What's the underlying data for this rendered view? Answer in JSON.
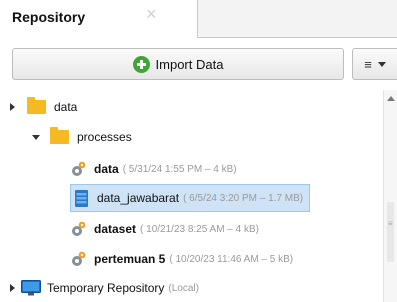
{
  "tab": {
    "title": "Repository",
    "close_glyph": "×"
  },
  "toolbar": {
    "import_label": "Import Data",
    "import_icon": "plus-circle-icon",
    "menu_glyph": "≡",
    "accent": "#3fa535"
  },
  "tree": {
    "data_folder": {
      "label": "data"
    },
    "processes_folder": {
      "label": "processes"
    },
    "items": [
      {
        "name": "data",
        "meta": "( 5/31/24 1:55 PM – 4 kB)",
        "icon": "gear-process-icon"
      },
      {
        "name": "data_jawabarat",
        "meta": "( 6/5/24 3:20 PM – 1.7 MB)",
        "icon": "data-table-icon",
        "selected": true
      },
      {
        "name": "dataset",
        "meta": "( 10/21/23 8:25 AM – 4 kB)",
        "icon": "gear-process-icon"
      },
      {
        "name": "pertemuan 5",
        "meta": "( 10/20/23 11:46 AM – 5 kB)",
        "icon": "gear-process-icon"
      }
    ],
    "temp_repo": {
      "label": "Temporary Repository",
      "meta": "(Local)"
    }
  },
  "colors": {
    "folder": "#f5b922",
    "selection": "#cfe3f7",
    "meta_text": "#9a9a9a"
  }
}
